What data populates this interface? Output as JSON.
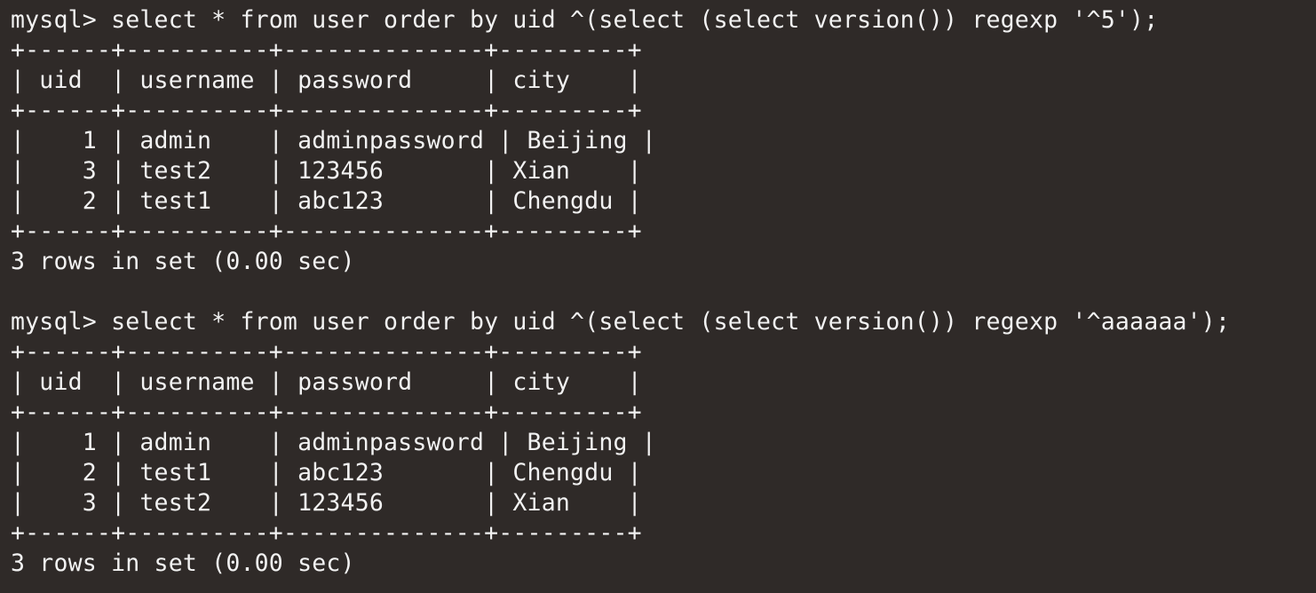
{
  "session": {
    "blocks": [
      {
        "command": "mysql> select * from user order by uid ^(select (select version()) regexp '^5');",
        "border": "+------+----------+--------------+---------+",
        "header": "| uid  | username | password     | city    |",
        "rows": [
          "|    1 | admin    | adminpassword | Beijing |",
          "|    3 | test2    | 123456       | Xian    |",
          "|    2 | test1    | abc123       | Chengdu |"
        ],
        "summary": "3 rows in set (0.00 sec)"
      },
      {
        "command": "mysql> select * from user order by uid ^(select (select version()) regexp '^aaaaaa');",
        "border": "+------+----------+--------------+---------+",
        "header": "| uid  | username | password     | city    |",
        "rows": [
          "|    1 | admin    | adminpassword | Beijing |",
          "|    2 | test1    | abc123       | Chengdu |",
          "|    3 | test2    | 123456       | Xian    |"
        ],
        "summary": "3 rows in set (0.00 sec)"
      }
    ]
  },
  "colors": {
    "background": "#2f2a28",
    "foreground": "#f2f2f2"
  }
}
